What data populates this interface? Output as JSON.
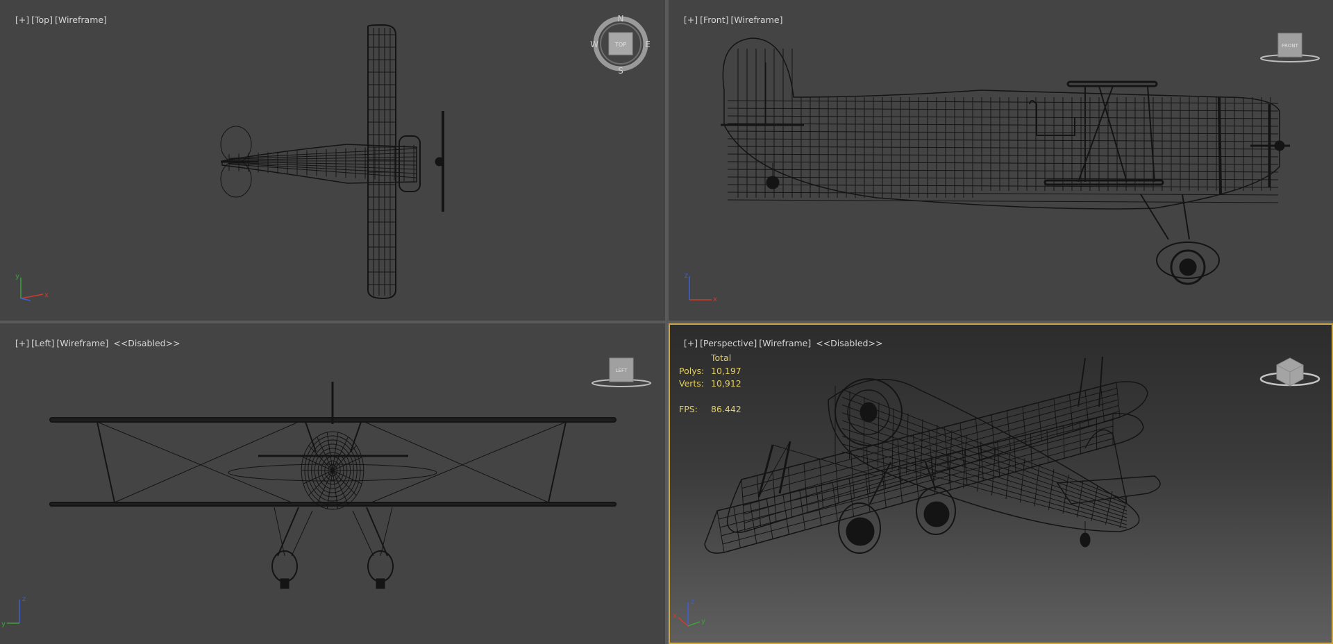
{
  "viewports": [
    {
      "id": "top",
      "labels": [
        "[+]",
        "[Top]",
        "[Wireframe]"
      ],
      "widget": {
        "kind": "viewcube-compass",
        "face": "TOP",
        "compass": [
          "N",
          "E",
          "S",
          "W"
        ]
      },
      "axes": [
        "y",
        "x"
      ]
    },
    {
      "id": "front",
      "labels": [
        "[+]",
        "[Front]",
        "[Wireframe]"
      ],
      "widget": {
        "kind": "viewcube",
        "face": "FRONT"
      },
      "axes": [
        "z",
        "x"
      ]
    },
    {
      "id": "left",
      "labels": [
        "[+]",
        "[Left]",
        "[Wireframe]",
        "<<Disabled>>"
      ],
      "widget": {
        "kind": "viewcube",
        "face": "LEFT"
      },
      "axes": [
        "z",
        "y"
      ]
    },
    {
      "id": "perspective",
      "labels": [
        "[+]",
        "[Perspective]",
        "[Wireframe]",
        "<<Disabled>>"
      ],
      "active": true,
      "widget": {
        "kind": "viewcube",
        "face": "FRONT LEFT"
      },
      "stats": {
        "header": "Total",
        "polys_label": "Polys:",
        "polys": "10,197",
        "verts_label": "Verts:",
        "verts": "10,912",
        "fps_label": "FPS:",
        "fps": "86.442"
      },
      "axes": [
        "z",
        "y",
        "x"
      ]
    }
  ],
  "colors": {
    "viewport_bg": "#444444",
    "wire": "#141414",
    "label": "#d6d6d6",
    "stats": "#e3cf62",
    "active_border": "#c8a84b",
    "axis_x": "#d23a2a",
    "axis_y": "#3ca23c",
    "axis_z": "#3d5fd6"
  }
}
